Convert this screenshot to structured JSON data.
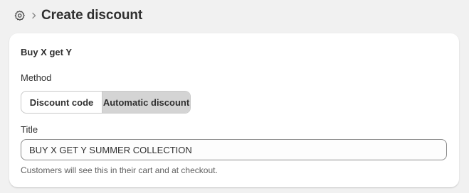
{
  "header": {
    "title": "Create discount",
    "icon": "settings-gear-icon",
    "separator_icon": "chevron-right-icon"
  },
  "card": {
    "title": "Buy X get Y",
    "method": {
      "label": "Method",
      "options": [
        "Discount code",
        "Automatic discount"
      ],
      "selected": "Automatic discount"
    },
    "title_field": {
      "label": "Title",
      "value": "BUY X GET Y SUMMER COLLECTION",
      "help_text": "Customers will see this in their cart and at checkout."
    }
  },
  "colors": {
    "page_bg": "#f1f1f1",
    "card_bg": "#ffffff",
    "selected_segment_bg": "#d4d4d4",
    "text": "#303030",
    "help_text": "#616161"
  }
}
